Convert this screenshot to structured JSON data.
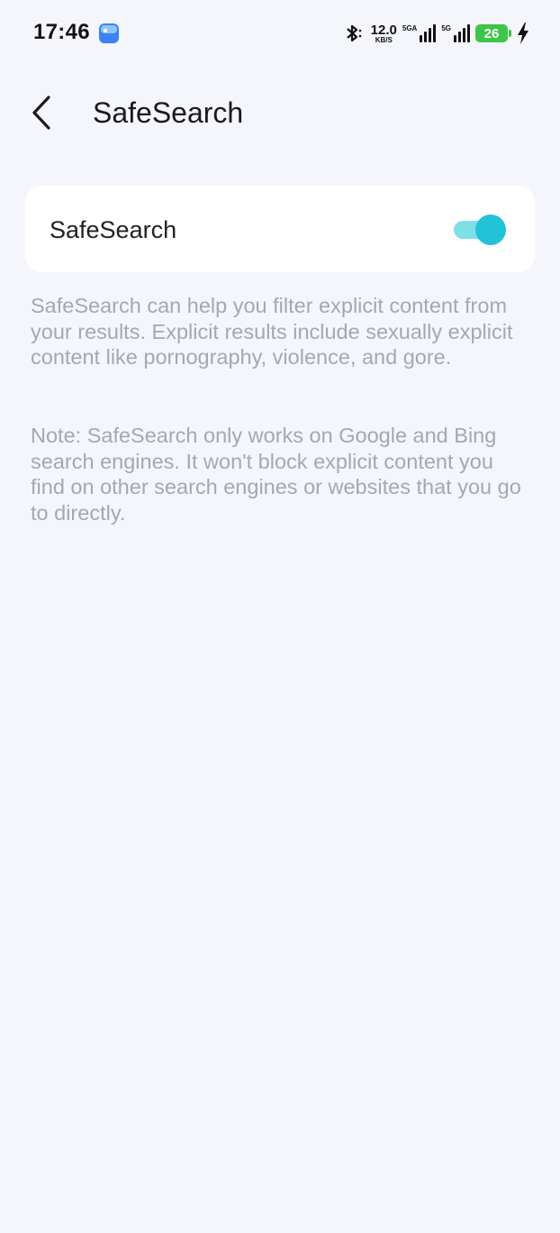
{
  "status_bar": {
    "time": "17:46",
    "speed_value": "12.0",
    "speed_unit": "KB/S",
    "sim1_label": "5GA",
    "sim2_label": "5G",
    "battery_level": "26",
    "icons": [
      "gallery-icon",
      "bluetooth-icon",
      "signal-icon",
      "battery-icon",
      "charging-icon"
    ]
  },
  "header": {
    "back_icon": "chevron-left-icon",
    "title": "SafeSearch"
  },
  "setting": {
    "label": "SafeSearch",
    "enabled": true,
    "toggle_color": "#20c4d6"
  },
  "description": {
    "paragraph1": "SafeSearch can help you filter explicit content from your results. Explicit results include sexually explicit content like pornography, violence, and gore.",
    "paragraph2": "Note: SafeSearch only works on Google and Bing search engines. It won't block explicit content you find on other search engines or websites that you go to directly."
  }
}
